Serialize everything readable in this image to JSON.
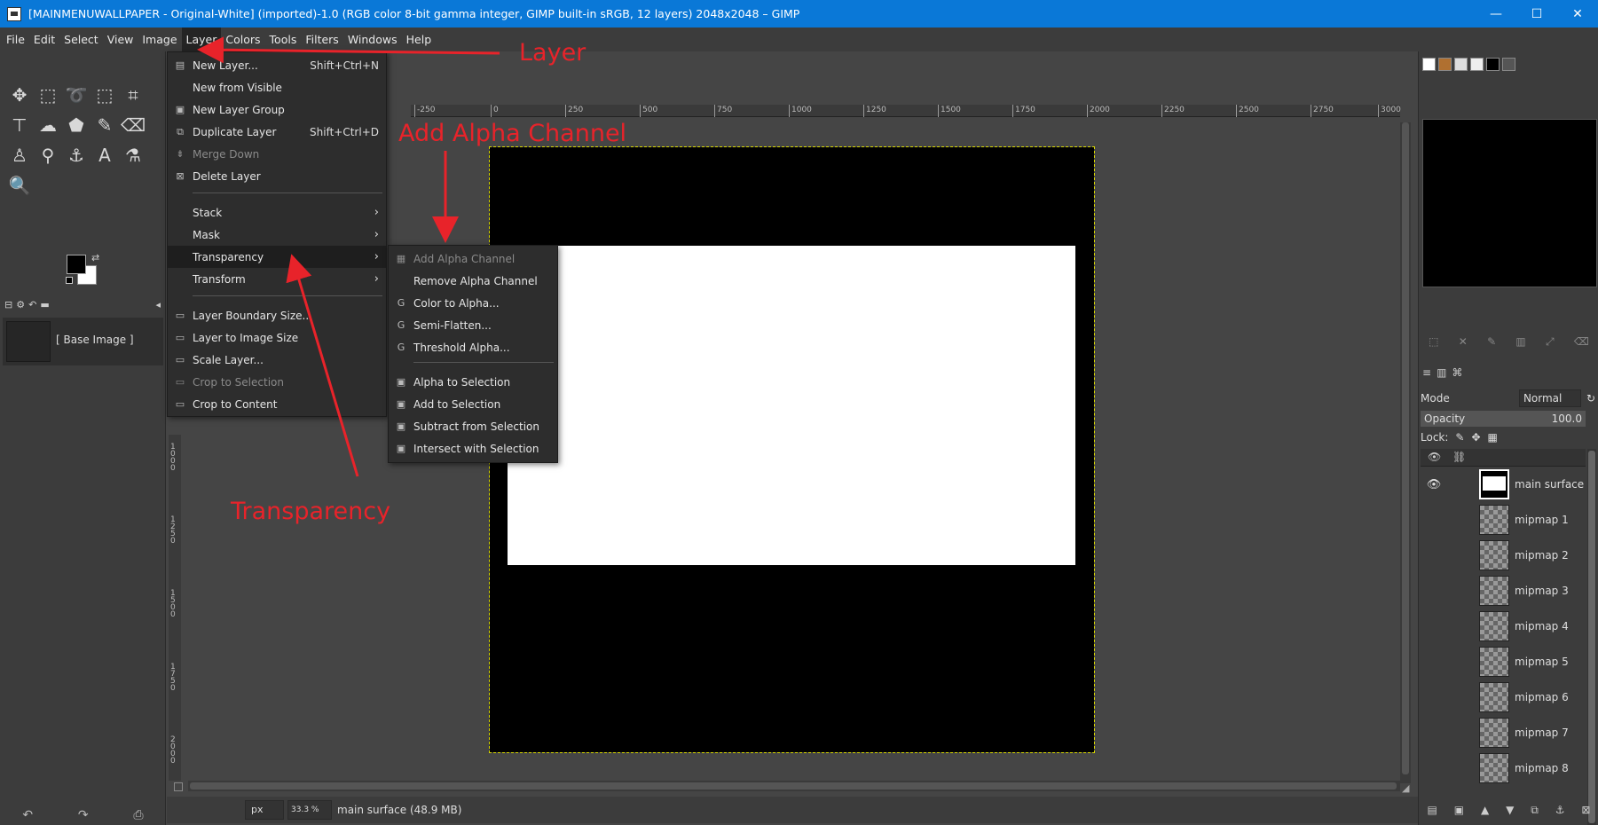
{
  "window": {
    "title": "[MAINMENUWALLPAPER - Original-White] (imported)-1.0 (RGB color 8-bit gamma integer, GIMP built-in sRGB, 12 layers) 2048x2048 – GIMP",
    "minimize": "—",
    "maximize": "☐",
    "close": "✕"
  },
  "menubar": [
    "File",
    "Edit",
    "Select",
    "View",
    "Image",
    "Layer",
    "Colors",
    "Tools",
    "Filters",
    "Windows",
    "Help"
  ],
  "layer_menu": {
    "items": [
      {
        "label": "New Layer...",
        "shortcut": "Shift+Ctrl+N",
        "icon": "new-layer-icon",
        "glyph": "▤"
      },
      {
        "label": "New from Visible",
        "shortcut": "",
        "icon": "",
        "glyph": ""
      },
      {
        "label": "New Layer Group",
        "shortcut": "",
        "icon": "layer-group-icon",
        "glyph": "▣"
      },
      {
        "label": "Duplicate Layer",
        "shortcut": "Shift+Ctrl+D",
        "icon": "duplicate-icon",
        "glyph": "⧉"
      },
      {
        "label": "Merge Down",
        "shortcut": "",
        "icon": "merge-down-icon",
        "glyph": "⇟",
        "disabled": true
      },
      {
        "label": "Delete Layer",
        "shortcut": "",
        "icon": "delete-icon",
        "glyph": "⊠"
      },
      {
        "label": "Stack",
        "submenu": true
      },
      {
        "label": "Mask",
        "submenu": true
      },
      {
        "label": "Transparency",
        "submenu": true,
        "highlighted": true
      },
      {
        "label": "Transform",
        "submenu": true
      },
      {
        "label": "Layer Boundary Size...",
        "icon": "boundary-icon",
        "glyph": "▭"
      },
      {
        "label": "Layer to Image Size",
        "icon": "to-image-size-icon",
        "glyph": "▭"
      },
      {
        "label": "Scale Layer...",
        "icon": "scale-icon",
        "glyph": "▭"
      },
      {
        "label": "Crop to Selection",
        "icon": "crop-icon",
        "glyph": "▭",
        "disabled": true
      },
      {
        "label": "Crop to Content",
        "icon": "crop-icon",
        "glyph": "▭"
      }
    ]
  },
  "transparency_menu": {
    "items": [
      {
        "label": "Add Alpha Channel",
        "icon": "alpha-icon",
        "glyph": "▦",
        "disabled": true
      },
      {
        "label": "Remove Alpha Channel",
        "icon": "",
        "glyph": ""
      },
      {
        "label": "Color to Alpha...",
        "icon": "gegl-icon",
        "glyph": "G"
      },
      {
        "label": "Semi-Flatten...",
        "icon": "gegl-icon",
        "glyph": "G"
      },
      {
        "label": "Threshold Alpha...",
        "icon": "gegl-icon",
        "glyph": "G"
      },
      {
        "label": "Alpha to Selection",
        "icon": "selection-icon",
        "glyph": "▣"
      },
      {
        "label": "Add to Selection",
        "icon": "selection-add-icon",
        "glyph": "▣"
      },
      {
        "label": "Subtract from Selection",
        "icon": "selection-subtract-icon",
        "glyph": "▣"
      },
      {
        "label": "Intersect with Selection",
        "icon": "selection-intersect-icon",
        "glyph": "▣"
      }
    ]
  },
  "annotations": {
    "layer": "Layer",
    "add_alpha": "Add Alpha Channel",
    "transparency": "Transparency",
    "color": "#e8232a"
  },
  "toolbox": {
    "tools": [
      "✥",
      "⬚",
      "➰",
      "⬚",
      "⌗",
      "⊤",
      "☁",
      "⬟",
      "✎",
      "⌫",
      "♙",
      "⚲",
      "⚓",
      "A",
      "⚗",
      "🔍"
    ]
  },
  "images_panel": {
    "item": "[ Base Image ]"
  },
  "ruler": {
    "ticks": [
      "-250",
      "0",
      "250",
      "500",
      "750",
      "1000",
      "1250",
      "1500",
      "1750",
      "2000",
      "2250",
      "2500",
      "2750",
      "3000"
    ],
    "v_ticks": [
      "1000",
      "1250",
      "1500",
      "1750",
      "2000"
    ]
  },
  "statusbar": {
    "unit": "px",
    "zoom": "33.3 %",
    "info": "main surface (48.9 MB)"
  },
  "layers_panel": {
    "mode_label": "Mode",
    "mode_value": "Normal",
    "opacity_label": "Opacity",
    "opacity_value": "100.0",
    "lock_label": "Lock:",
    "layers": [
      "main surface",
      "mipmap 1",
      "mipmap 2",
      "mipmap 3",
      "mipmap 4",
      "mipmap 5",
      "mipmap 6",
      "mipmap 7",
      "mipmap 8"
    ]
  },
  "colors": {
    "titlebar": "#0a78d7",
    "fg": "#000000",
    "bg": "#ffffff"
  }
}
